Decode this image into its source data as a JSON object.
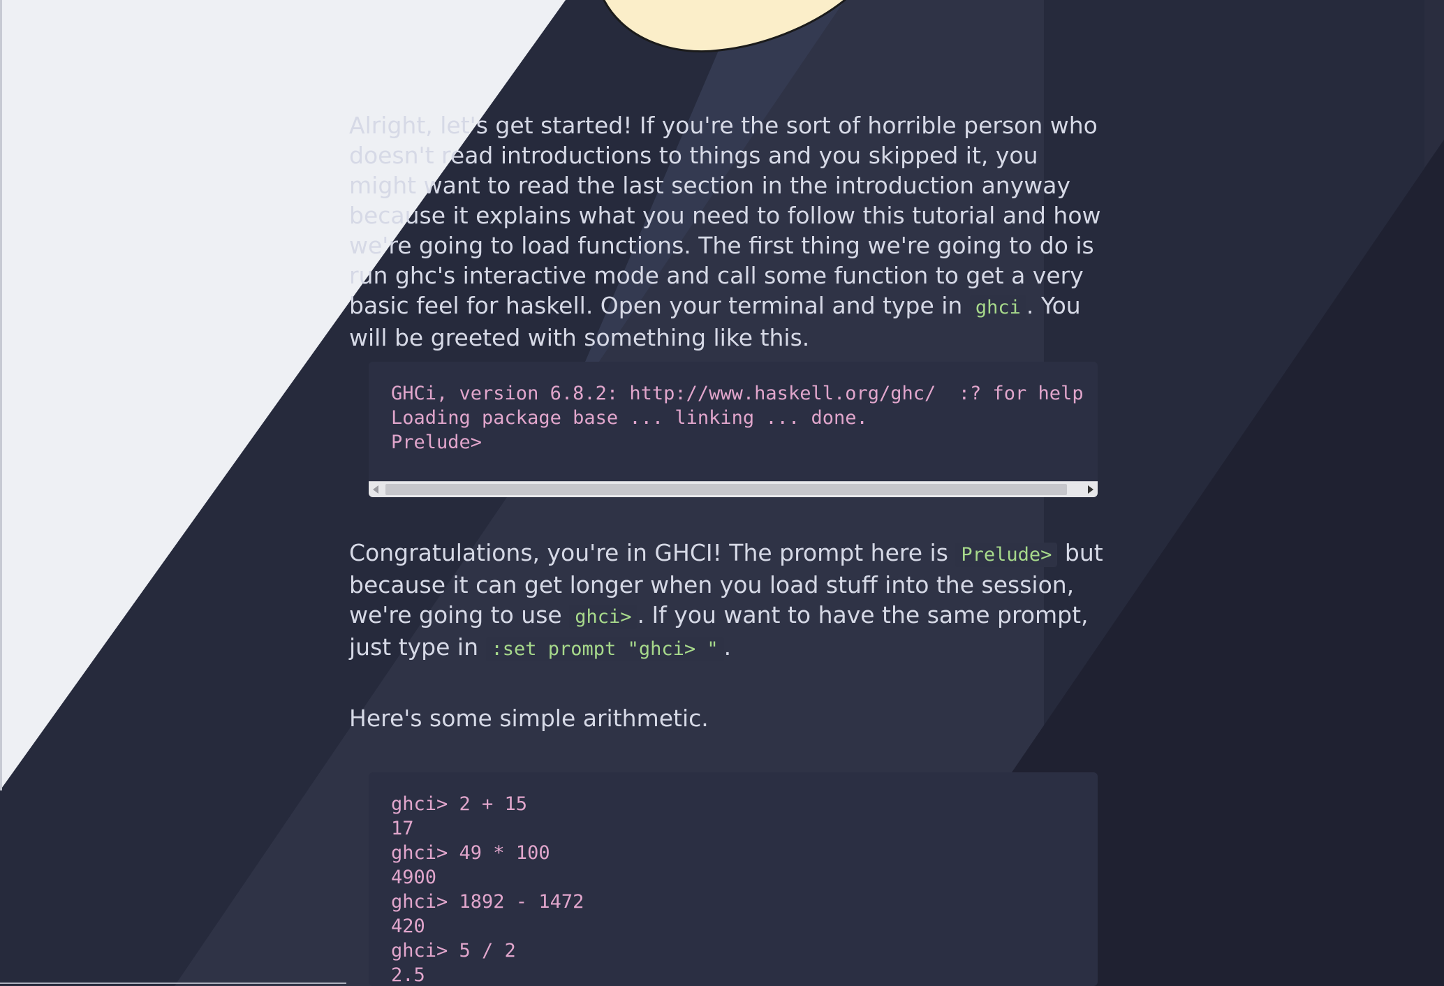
{
  "article": {
    "para1": {
      "text_before": "Alright, let's get started! If you're the sort of horrible person who doesn't read introductions to things and you skipped it, you might want to read the last section in the introduction anyway because it explains what you need to follow this tutorial and how we're going to load functions. The first thing we're going to do is run ghc's interactive mode and call some function to get a very basic feel for haskell. Open your terminal and type in ",
      "code": "ghci",
      "text_after": ". You will be greeted with something like this."
    },
    "code_block_1": {
      "lines": "GHCi, version 6.8.2: http://www.haskell.org/ghc/  :? for help\nLoading package base ... linking ... done.\nPrelude>"
    },
    "para2": {
      "text_1": "Congratulations, you're in GHCI! The prompt here is ",
      "code_1": "Prelude>",
      "text_2": " but because it can get longer when you load stuff into the session, we're going to use ",
      "code_2": "ghci>",
      "text_3": ". If you want to have the same prompt, just type in ",
      "code_3": ":set prompt \"ghci> \"",
      "text_4": "."
    },
    "para3": {
      "text": "Here's some simple arithmetic."
    },
    "code_block_2": {
      "lines": "ghci> 2 + 15\n17\nghci> 49 * 100\n4900\nghci> 1892 - 1472\n420\nghci> 5 / 2\n2.5"
    }
  },
  "colors": {
    "background_dark": "#262a3c",
    "background_light": "#eef0f4",
    "body_text": "#d6d9e6",
    "inline_code": "#a7d98b",
    "code_text": "#e1a6cc",
    "code_bg": "#2b2f43"
  }
}
